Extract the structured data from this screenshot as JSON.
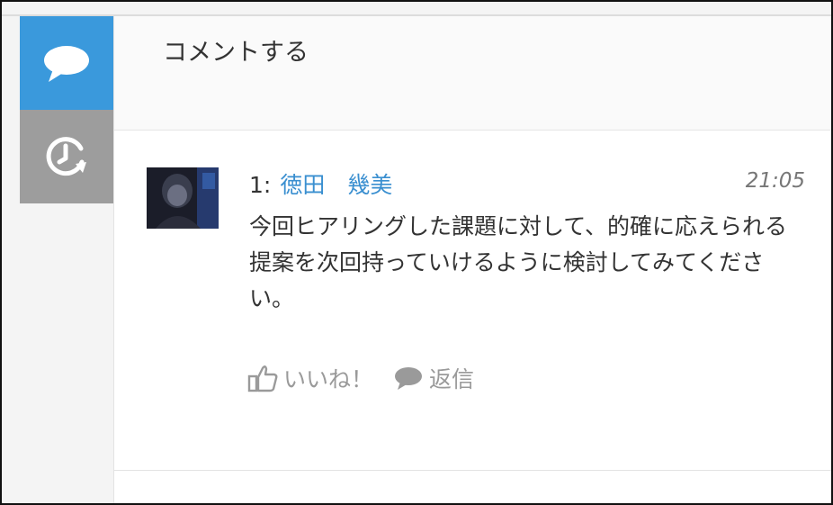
{
  "sidebar": {
    "tabs": [
      {
        "name": "comment",
        "icon": "speech-bubble-icon",
        "active": true
      },
      {
        "name": "history",
        "icon": "clock-history-icon",
        "active": false
      }
    ]
  },
  "compose": {
    "placeholder": "コメントする"
  },
  "comment": {
    "number": "1:",
    "author": "徳田　幾美",
    "time": "21:05",
    "body": "今回ヒアリングした課題に対して、的確に応えられる提案を次回持っていけるように検討してみてください。",
    "actions": {
      "like_label": "いいね！",
      "like_icon": "thumbs-up-icon",
      "reply_label": "返信",
      "reply_icon": "speech-bubble-icon"
    }
  },
  "colors": {
    "accent": "#3a99dc",
    "inactive_tab": "#9d9d9d",
    "link": "#3a8fd0",
    "text": "#333333",
    "muted": "#9a9a9a"
  }
}
